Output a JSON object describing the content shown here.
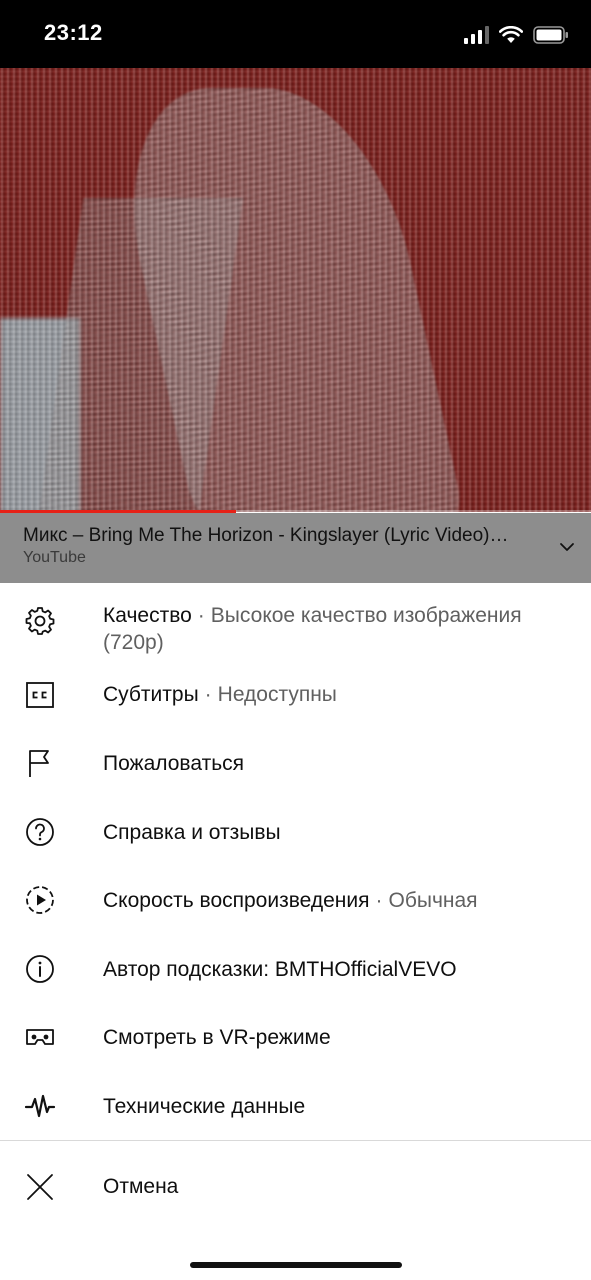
{
  "status_bar": {
    "time": "23:12"
  },
  "player": {
    "title": "Микс – Bring Me The Horizon - Kingslayer (Lyric Video)…",
    "channel": "YouTube",
    "progress_fraction": 0.4
  },
  "menu": {
    "quality": {
      "label": "Качество",
      "sep": "·",
      "value": "Высокое качество изображения (720p)"
    },
    "subtitles": {
      "label": "Субтитры",
      "sep": "·",
      "value": "Недоступны"
    },
    "report": {
      "label": "Пожаловаться"
    },
    "help": {
      "label": "Справка и отзывы"
    },
    "speed": {
      "label": "Скорость воспроизведения",
      "sep": "·",
      "value": "Обычная"
    },
    "annotation": {
      "label": "Автор подсказки: BMTHOfficialVEVO"
    },
    "vr": {
      "label": "Смотреть в VR-режиме"
    },
    "stats": {
      "label": "Технические данные"
    },
    "cancel": {
      "label": "Отмена"
    }
  }
}
